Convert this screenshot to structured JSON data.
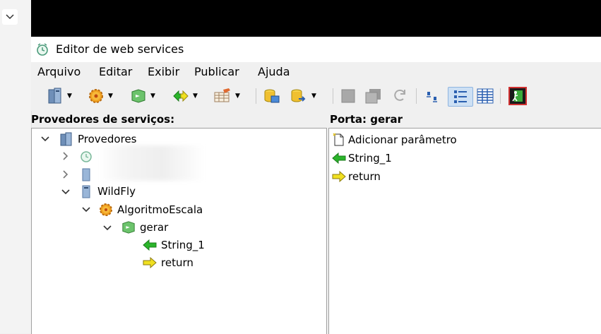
{
  "window": {
    "title": "Editor de web services"
  },
  "menu": [
    "Arquivo",
    "Editar",
    "Exibir",
    "Publicar",
    "Ajuda"
  ],
  "left_panel": {
    "header": "Provedores de serviços:",
    "tree": {
      "root": "Provedores",
      "wildfly": "WildFly",
      "service": "AlgoritmoEscala",
      "port": "gerar",
      "param": "String_1",
      "ret": "return"
    }
  },
  "right_panel": {
    "header": "Porta: gerar",
    "items": [
      "Adicionar parâmetro",
      "String_1",
      "return"
    ]
  },
  "icons": {
    "title": "webservice-clock-icon",
    "provider": "server-icon",
    "service": "gear-icon",
    "port": "port-icon",
    "input": "green-left-arrow-icon",
    "output": "yellow-right-arrow-icon",
    "new_param": "new-document-icon"
  },
  "colors": {
    "selection_blue": "#cde0f4",
    "input_green": "#2bb52b",
    "output_yellow": "#f0e020"
  }
}
